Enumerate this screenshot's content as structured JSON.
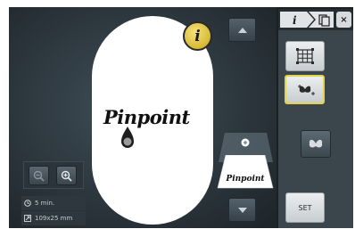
{
  "design": {
    "text": "Pinpoint"
  },
  "info_button": {
    "label": "i"
  },
  "thumbnail": {
    "label": "Pinpoint"
  },
  "stats": {
    "time": "5 min.",
    "size": "109x25 mm"
  },
  "tabs": {
    "first": "i"
  },
  "close": {
    "label": "×"
  },
  "right_panel": {
    "set_label": "SET"
  },
  "colors": {
    "accent": "#e3d34a",
    "info_yellow": "#d9bd22",
    "background": "#1b2023"
  }
}
